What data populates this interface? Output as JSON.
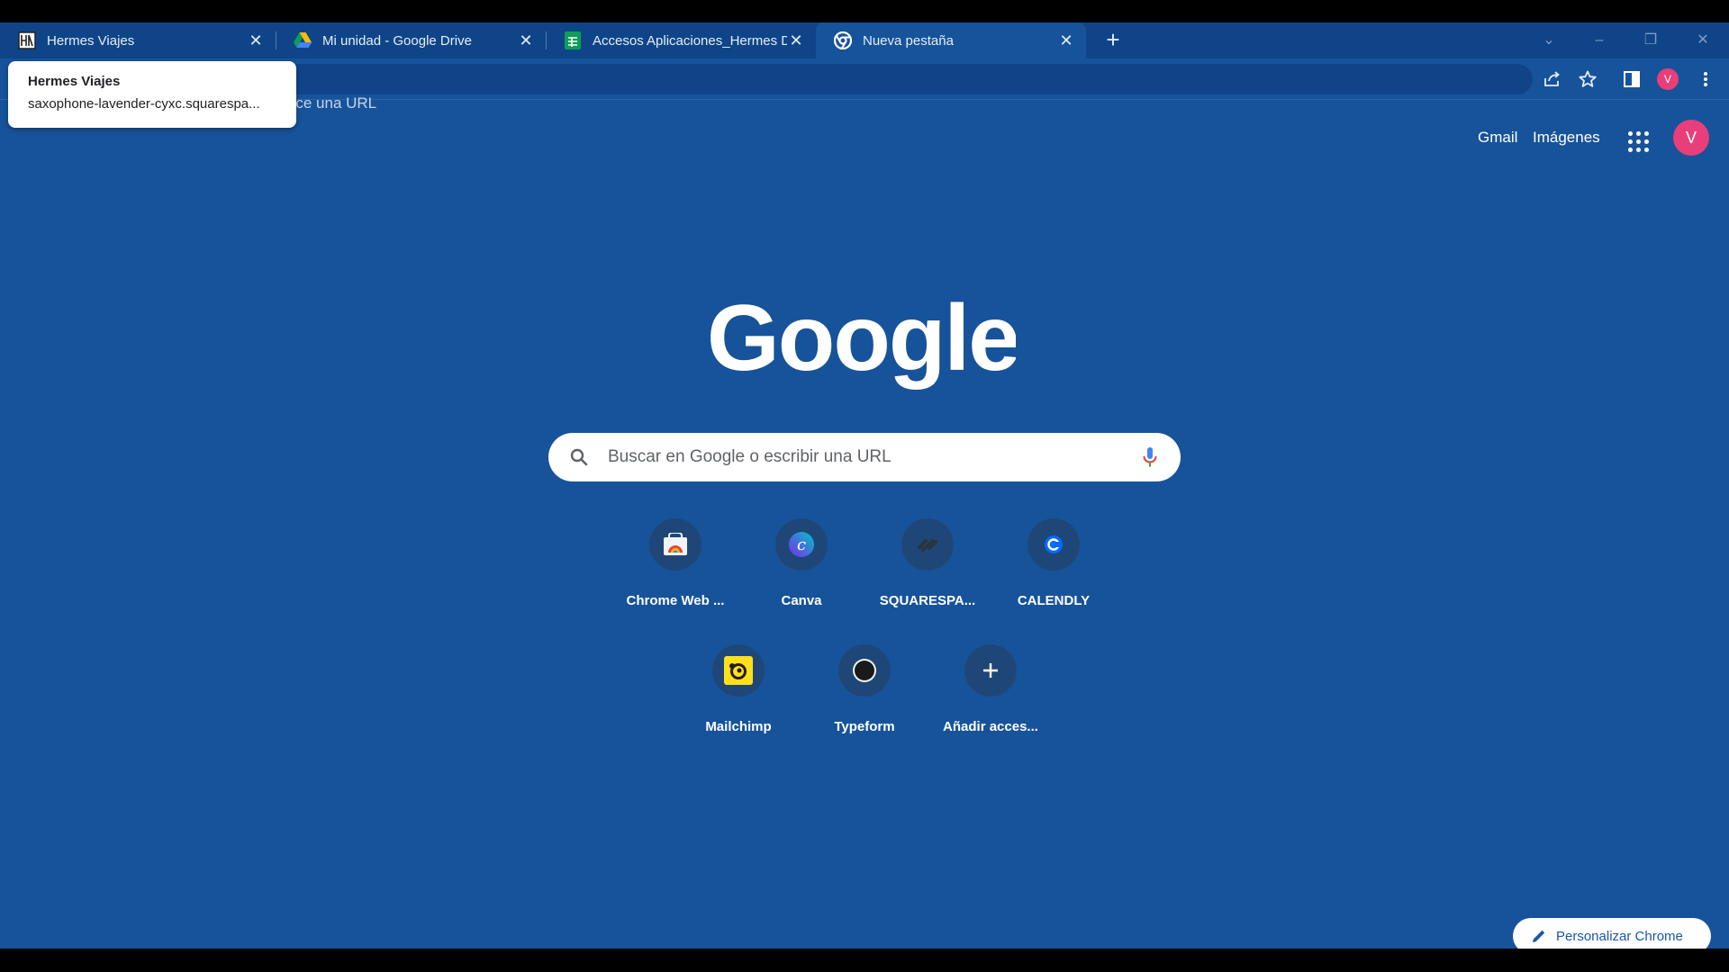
{
  "browser": {
    "tabs": [
      {
        "title": "Hermes Viajes",
        "favicon": "hermes-favicon-icon"
      },
      {
        "title": "Mi unidad - Google Drive",
        "favicon": "google-drive-icon"
      },
      {
        "title": "Accesos Aplicaciones_Hermes Di",
        "favicon": "google-sheets-icon"
      },
      {
        "title": "Nueva pestaña",
        "favicon": "chrome-icon",
        "active": true
      }
    ],
    "new_tab_symbol": "+",
    "omnibox_text": "oduce una URL",
    "profile_initial": "V",
    "tooltip": {
      "title": "Hermes Viajes",
      "url": "saxophone-lavender-cyxc.squarespa..."
    }
  },
  "page": {
    "top_links": {
      "gmail": "Gmail",
      "images": "Imágenes"
    },
    "avatar_initial": "V",
    "logo_text": "Google",
    "search": {
      "placeholder": "Buscar en Google o escribir una URL"
    },
    "shortcuts": [
      {
        "label": "Chrome Web ...",
        "icon": "chrome-web-store-icon"
      },
      {
        "label": "Canva",
        "icon": "canva-icon"
      },
      {
        "label": "SQUARESPA...",
        "icon": "squarespace-icon"
      },
      {
        "label": "CALENDLY",
        "icon": "calendly-icon"
      },
      {
        "label": "Mailchimp",
        "icon": "mailchimp-icon"
      },
      {
        "label": "Typeform",
        "icon": "typeform-icon"
      },
      {
        "label": "Añadir acces...",
        "icon": "add-icon"
      }
    ],
    "customize_label": "Personalizar Chrome"
  },
  "colors": {
    "background": "#17539a",
    "tabstrip": "#0f4588",
    "avatar": "#e83e79"
  }
}
